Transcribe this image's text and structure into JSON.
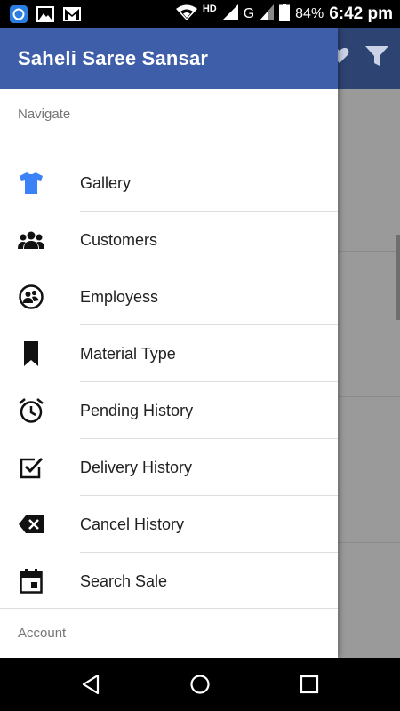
{
  "status_bar": {
    "battery": "84%",
    "time": "6:42 pm",
    "network_hd": "HD",
    "network_g": "G"
  },
  "drawer": {
    "title": "Saheli Saree Sansar",
    "navigate_label": "Navigate",
    "account_label": "Account",
    "items": [
      {
        "label": "Gallery",
        "icon": "shirt-icon"
      },
      {
        "label": "Customers",
        "icon": "group-icon"
      },
      {
        "label": "Employess",
        "icon": "people-circle-icon"
      },
      {
        "label": "Material Type",
        "icon": "bookmark-icon"
      },
      {
        "label": "Pending History",
        "icon": "alarm-icon"
      },
      {
        "label": "Delivery History",
        "icon": "checkbox-icon"
      },
      {
        "label": "Cancel History",
        "icon": "backspace-icon"
      },
      {
        "label": "Search Sale",
        "icon": "calendar-icon"
      }
    ]
  },
  "colors": {
    "header": "#3f5ea9",
    "gallery_icon": "#3b82f6",
    "background_header": "#2d4472"
  }
}
